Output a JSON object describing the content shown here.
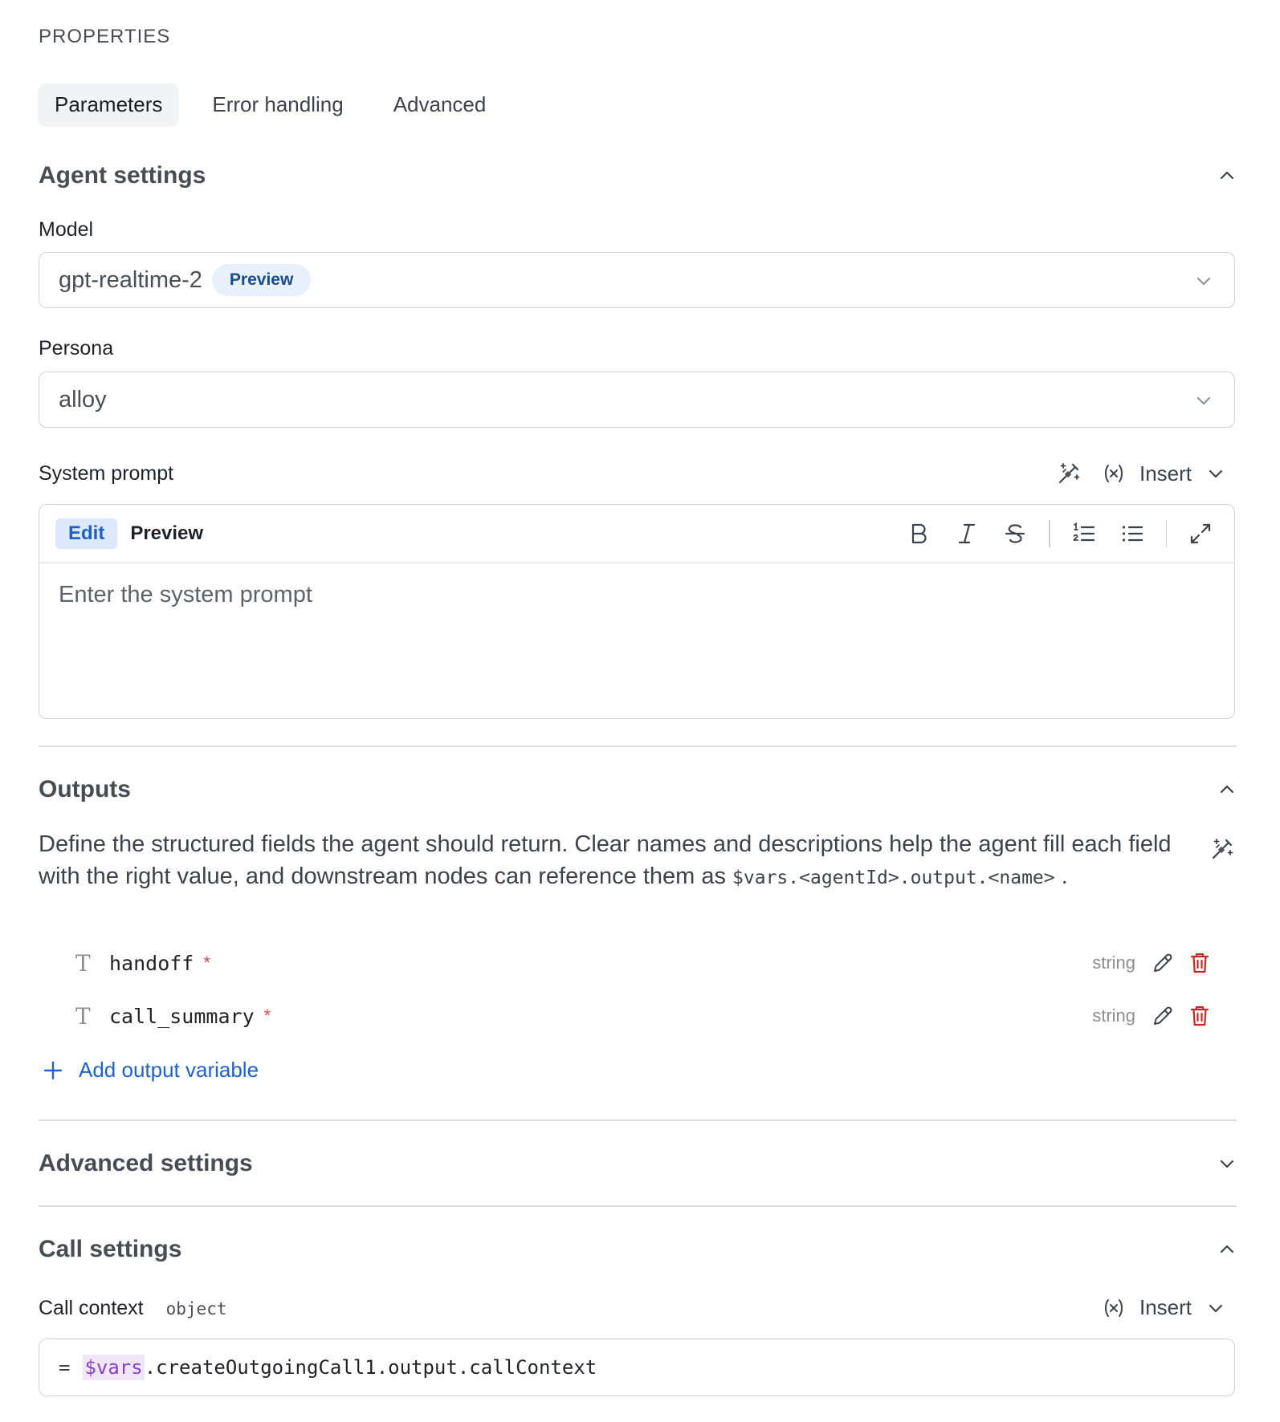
{
  "panel": {
    "title": "PROPERTIES"
  },
  "tabs": [
    {
      "label": "Parameters",
      "active": true
    },
    {
      "label": "Error handling",
      "active": false
    },
    {
      "label": "Advanced",
      "active": false
    }
  ],
  "agent_settings": {
    "title": "Agent settings",
    "model": {
      "label": "Model",
      "value": "gpt-realtime-2",
      "badge": "Preview"
    },
    "persona": {
      "label": "Persona",
      "value": "alloy"
    },
    "system_prompt": {
      "label": "System prompt",
      "insert_label": "Insert",
      "modes": {
        "edit": "Edit",
        "preview": "Preview"
      },
      "placeholder": "Enter the system prompt",
      "toolbar_icons": [
        "bold-icon",
        "italic-icon",
        "strikethrough-icon",
        "ordered-list-icon",
        "bullet-list-icon",
        "expand-icon"
      ]
    }
  },
  "outputs": {
    "title": "Outputs",
    "description_prefix": "Define the structured fields the agent should return. Clear names and descriptions help the agent fill each field with the right value, and downstream nodes can reference them as",
    "description_code": "$vars.<agentId>.output.<name>",
    "description_suffix": ".",
    "items": [
      {
        "name": "handoff",
        "type": "string",
        "required_mark": "*"
      },
      {
        "name": "call_summary",
        "type": "string",
        "required_mark": "*"
      }
    ],
    "add_label": "Add output variable"
  },
  "advanced_settings": {
    "title": "Advanced settings"
  },
  "call_settings": {
    "title": "Call settings",
    "call_context": {
      "label": "Call context",
      "type": "object",
      "insert_label": "Insert",
      "eq": "=",
      "expr_vars": "$vars",
      "expr_rest": ".createOutgoingCall1.output.callContext"
    }
  },
  "colors": {
    "accent": "#1f62c9",
    "danger": "#c62828",
    "vars_highlight": "#8a3fc4"
  }
}
